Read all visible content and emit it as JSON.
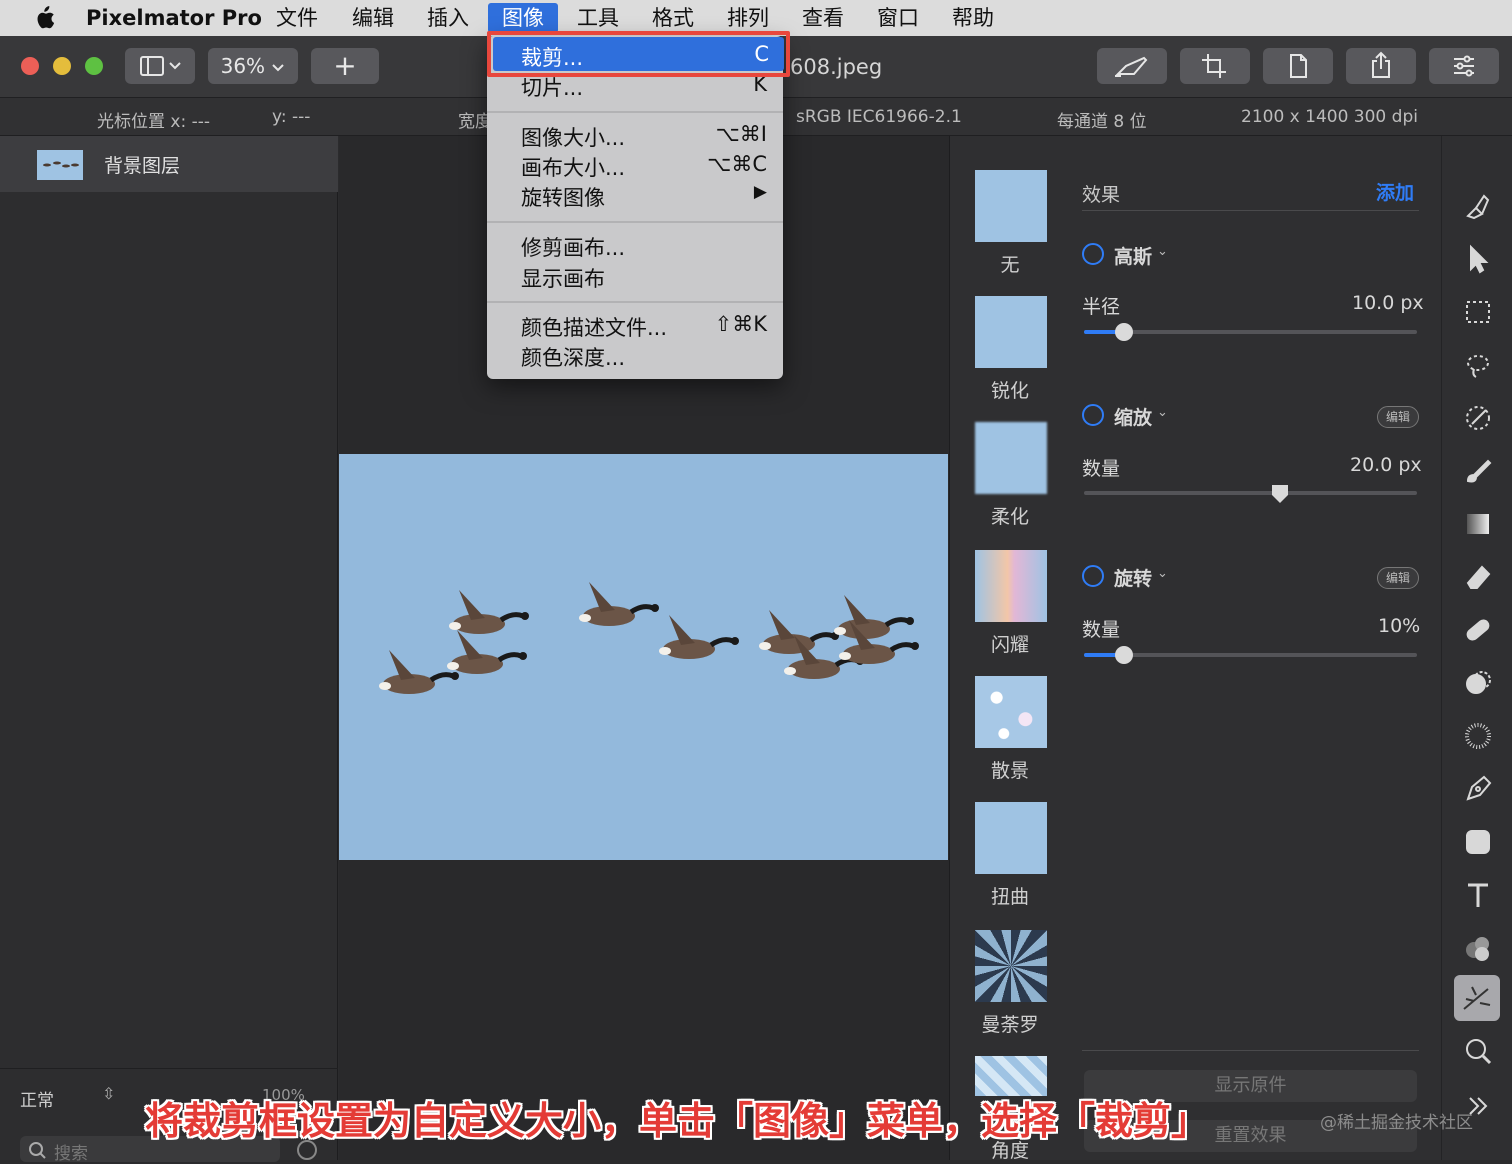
{
  "menubar": {
    "app_name": "Pixelmator Pro",
    "items": [
      "文件",
      "编辑",
      "插入",
      "图像",
      "工具",
      "格式",
      "排列",
      "查看",
      "窗口",
      "帮助"
    ]
  },
  "toolbar": {
    "zoom": "36%",
    "add_label": "+",
    "file_title": "608.jpeg"
  },
  "infobar": {
    "cursor_x": "光标位置 x: ---",
    "cursor_y": "y: ---",
    "width_label": "宽度",
    "color_profile": "sRGB IEC61966-2.1",
    "bit_depth": "每通道 8 位",
    "dimensions": "2100 x 1400 300 dpi"
  },
  "layers": {
    "layer_name": "背景图层",
    "blend_mode": "正常",
    "opacity": "100%",
    "search_placeholder": "搜索"
  },
  "image_menu": {
    "items": [
      {
        "label": "裁剪...",
        "shortcut": "C"
      },
      {
        "label": "切片...",
        "shortcut": "K"
      },
      {
        "label": "图像大小...",
        "shortcut": "⌥⌘I"
      },
      {
        "label": "画布大小...",
        "shortcut": "⌥⌘C"
      },
      {
        "label": "旋转图像",
        "shortcut": "▶"
      },
      {
        "label": "修剪画布...",
        "shortcut": ""
      },
      {
        "label": "显示画布",
        "shortcut": ""
      },
      {
        "label": "颜色描述文件...",
        "shortcut": "⇧⌘K"
      },
      {
        "label": "颜色深度...",
        "shortcut": ""
      }
    ]
  },
  "effects_strip": {
    "items": [
      "无",
      "锐化",
      "柔化",
      "闪耀",
      "散景",
      "扭曲",
      "曼荼罗",
      "角度"
    ]
  },
  "effects_panel": {
    "title": "效果",
    "add_label": "添加",
    "effects": [
      {
        "name": "高斯",
        "param_label": "半径",
        "param_value": "10.0 px",
        "level": 0.12
      },
      {
        "name": "缩放",
        "param_label": "数量",
        "param_value": "20.0 px",
        "level": 0.59,
        "edit_label": "编辑"
      },
      {
        "name": "旋转",
        "param_label": "数量",
        "param_value": "10%",
        "level": 0.12,
        "edit_label": "编辑"
      }
    ],
    "show_original": "显示原件",
    "reset_effects": "重置效果"
  },
  "caption": "将裁剪框设置为自定义大小，单击「图像」菜单，选择「裁剪」",
  "watermark": "@稀土掘金技术社区",
  "colors": {
    "accent": "#2f7cf6",
    "menu_highlight": "#2f6fdc",
    "callout_red": "#e8473d",
    "sky": "#93b9dc"
  }
}
